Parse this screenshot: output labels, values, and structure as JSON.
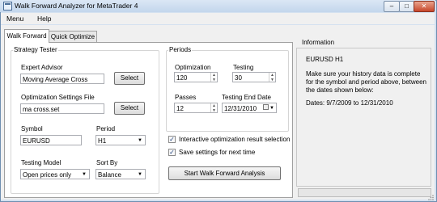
{
  "window": {
    "title": "Walk Forward Analyzer for MetaTrader 4"
  },
  "menu": {
    "items": [
      "Menu",
      "Help"
    ]
  },
  "tabs": [
    "Walk Forward",
    "Quick Optimize"
  ],
  "strategy_tester": {
    "title": "Strategy Tester",
    "expert_advisor_label": "Expert Advisor",
    "expert_advisor_value": "Moving Average Cross",
    "settings_file_label": "Optimization Settings File",
    "settings_file_value": "ma cross.set",
    "select_label": "Select",
    "symbol_label": "Symbol",
    "symbol_value": "EURUSD",
    "period_label": "Period",
    "period_value": "H1",
    "testing_model_label": "Testing Model",
    "testing_model_value": "Open prices only",
    "sort_by_label": "Sort By",
    "sort_by_value": "Balance"
  },
  "periods": {
    "title": "Periods",
    "optimization_label": "Optimization",
    "optimization_value": "120",
    "testing_label": "Testing",
    "testing_value": "30",
    "passes_label": "Passes",
    "passes_value": "12",
    "testing_end_date_label": "Testing End Date",
    "testing_end_date_value": "12/31/2010"
  },
  "options": {
    "interactive_label": "Interactive optimization result selection",
    "interactive_checked": true,
    "save_settings_label": "Save settings for next time",
    "save_settings_checked": true
  },
  "start_button_label": "Start Walk Forward Analysis",
  "information": {
    "title": "Information",
    "symbol_period": "EURUSD H1",
    "message": "Make sure your history data is complete for the symbol and period above, between the dates shown below:",
    "dates": "Dates: 9/7/2009 to 12/31/2010",
    "progress_fraction": 0
  },
  "colors": {
    "title_bar": "#c3d6ec",
    "close_button": "#c7462a",
    "check_mark": "#1d3f7a"
  }
}
